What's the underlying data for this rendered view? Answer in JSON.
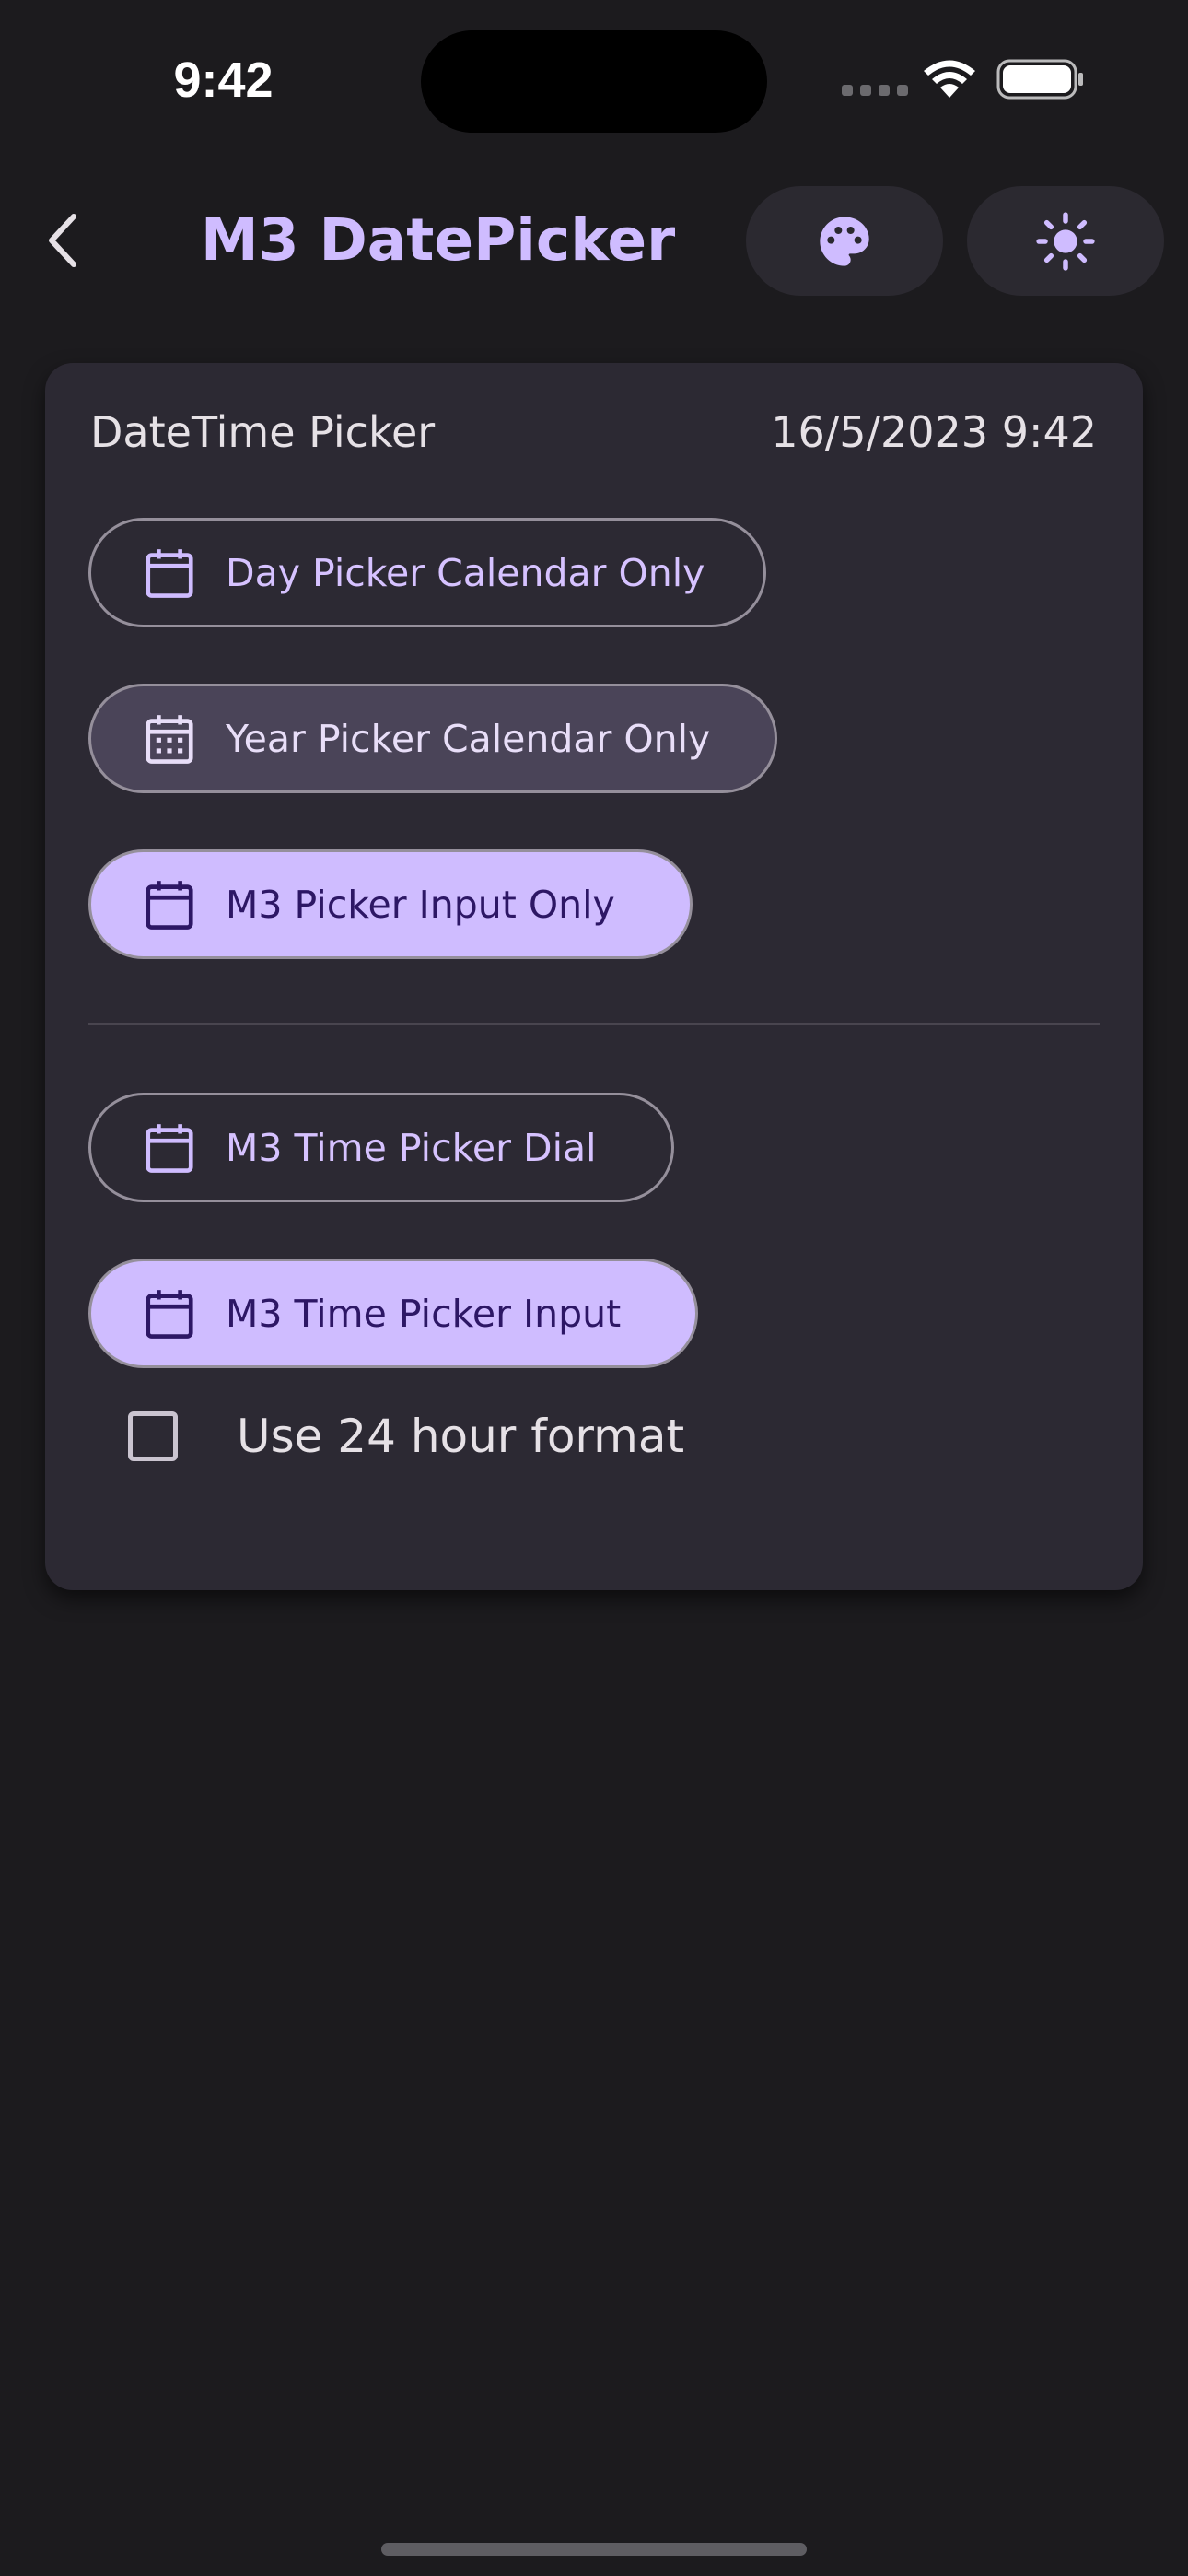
{
  "status_bar": {
    "time": "9:42"
  },
  "app_bar": {
    "title": "M3 DatePicker",
    "back_icon": "chevron-left-icon",
    "theme_icon": "palette-icon",
    "brightness_icon": "sun-icon"
  },
  "card": {
    "title": "DateTime Picker",
    "value": "16/5/2023 9:42",
    "date_buttons": [
      {
        "label": "Day Picker Calendar Only",
        "style": "outlined",
        "icon": "calendar-icon"
      },
      {
        "label": "Year Picker Calendar Only",
        "style": "tonal",
        "icon": "calendar-grid-icon"
      },
      {
        "label": "M3 Picker Input Only",
        "style": "filled",
        "icon": "calendar-icon"
      }
    ],
    "time_buttons": [
      {
        "label": "M3 Time Picker Dial",
        "style": "outlined",
        "icon": "calendar-icon"
      },
      {
        "label": "M3 Time Picker Input",
        "style": "filled",
        "icon": "calendar-icon"
      }
    ],
    "checkbox": {
      "label": "Use 24 hour format",
      "checked": false
    }
  },
  "colors": {
    "background": "#1c1b1e",
    "surface": "#2c2933",
    "primary": "#cfbcff",
    "on_primary_container": "#2d1765",
    "secondary_container": "#4a4458",
    "outline": "#958f9b"
  }
}
